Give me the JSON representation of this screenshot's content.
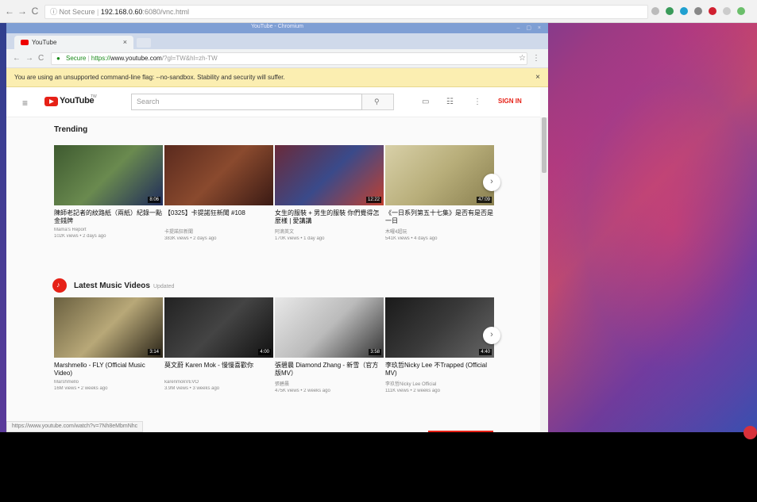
{
  "outer": {
    "back": "←",
    "forward": "→",
    "reload": "C",
    "not_secure": "Not Secure",
    "host": "192.168.0.60",
    "path": ":6080/vnc.html"
  },
  "inner": {
    "window_title": "YouTube - Chromium",
    "tab_title": "YouTube",
    "tab_close": "×",
    "secure": "Secure",
    "url_scheme": "https://",
    "url_domain": "www.youtube.com",
    "url_path": "/?gl=TW&hl=zh-TW",
    "flag_message": "You are using an unsupported command-line flag: --no-sandbox. Stability and security will suffer.",
    "flag_close": "×"
  },
  "youtube": {
    "logo_text": "YouTube",
    "logo_tm": "TW",
    "search_placeholder": "Search",
    "signin": "SIGN IN",
    "trending_title": "Trending",
    "music_title": "Latest Music Videos",
    "music_sub": "Updated",
    "trending": [
      {
        "title": "陳師老記者的紋路紙（兩紙）紀錄一點金錢牌",
        "channel": "Mama's Report",
        "meta": "102K views • 2 days ago",
        "duration": "8:06",
        "colors": [
          "#3e5a30",
          "#6a8a4f",
          "#1f2b5a"
        ]
      },
      {
        "title": "【0325】卡提諾狂新聞 #108",
        "channel": "卡提諾狂新聞",
        "meta": "383K views • 2 days ago",
        "duration": "",
        "colors": [
          "#5a2a1e",
          "#8a4a2e",
          "#3a1a14"
        ]
      },
      {
        "title": "女生的服裝 + 男生的服裝 你們覺得怎麼樣 | 愛講講",
        "channel": "阿滴英文",
        "meta": "170K views • 1 day ago",
        "duration": "12:22",
        "colors": [
          "#6a2a3a",
          "#3a4a8a",
          "#c04030"
        ]
      },
      {
        "title": "《一日系列第五十七集》是否有是否是一日",
        "channel": "木曜4超玩",
        "meta": "541K views • 4 days ago",
        "duration": "47:09",
        "colors": [
          "#d8d0a8",
          "#b8ae7a",
          "#8a8050"
        ]
      }
    ],
    "music": [
      {
        "title": "Marshmello - FLY (Official Music Video)",
        "channel": "Marshmello",
        "meta": "16M views • 2 weeks ago",
        "duration": "3:14",
        "colors": [
          "#6a6040",
          "#b8a878",
          "#2a2418"
        ]
      },
      {
        "title": "莫文蔚 Karen Mok - 慢慢喜歡你",
        "channel": "karenmokVEVO",
        "meta": "3.9M views • 3 weeks ago",
        "duration": "4:00",
        "colors": [
          "#222",
          "#444",
          "#111"
        ]
      },
      {
        "title": "張碧晨 Diamond Zhang - 新雪（官方版MV）",
        "channel": "張碧晨",
        "meta": "475K views • 2 weeks ago",
        "duration": "3:58",
        "colors": [
          "#e8e8e8",
          "#bbb",
          "#333"
        ]
      },
      {
        "title": "李玖哲Nicky Lee 不Trapped (Official MV)",
        "channel": "李玖哲Nicky Lee Official",
        "meta": "111K views • 2 weeks ago",
        "duration": "4:40",
        "colors": [
          "#1a1a1a",
          "#3a3a3a",
          "#666"
        ]
      }
    ],
    "next": "›"
  },
  "status_url": "https://www.youtube.com/watch?v=7Nh8eMbmNhc"
}
